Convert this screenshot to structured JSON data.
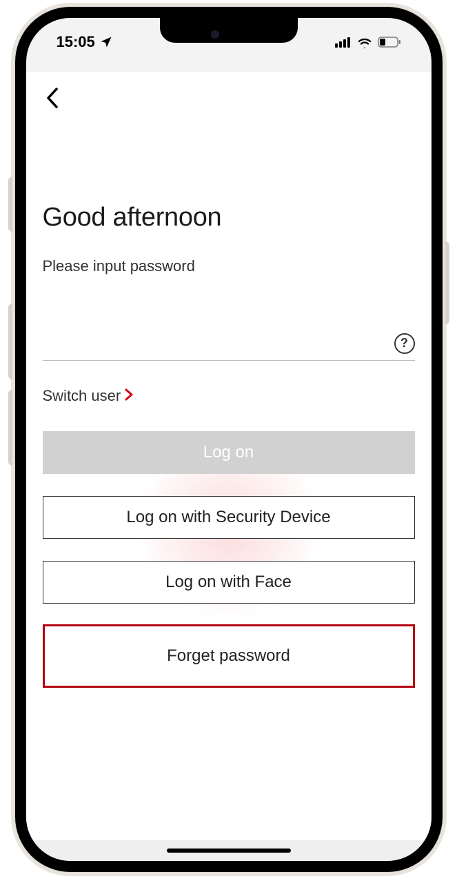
{
  "status": {
    "time": "15:05",
    "location_arrow": "location-arrow-icon",
    "signal": "signal-icon",
    "wifi": "wifi-icon",
    "battery": "battery-icon"
  },
  "header": {
    "back": "back-icon"
  },
  "login": {
    "greeting": "Good afternoon",
    "prompt": "Please input password",
    "help_symbol": "?",
    "password_value": "",
    "switch_user_label": "Switch user",
    "logon_label": "Log on",
    "security_device_label": "Log on with Security Device",
    "face_label": "Log on with Face",
    "forget_label": "Forget password"
  },
  "colors": {
    "accent": "#db0011",
    "highlight_border": "#b00010",
    "disabled_bg": "#d1d1d1"
  }
}
